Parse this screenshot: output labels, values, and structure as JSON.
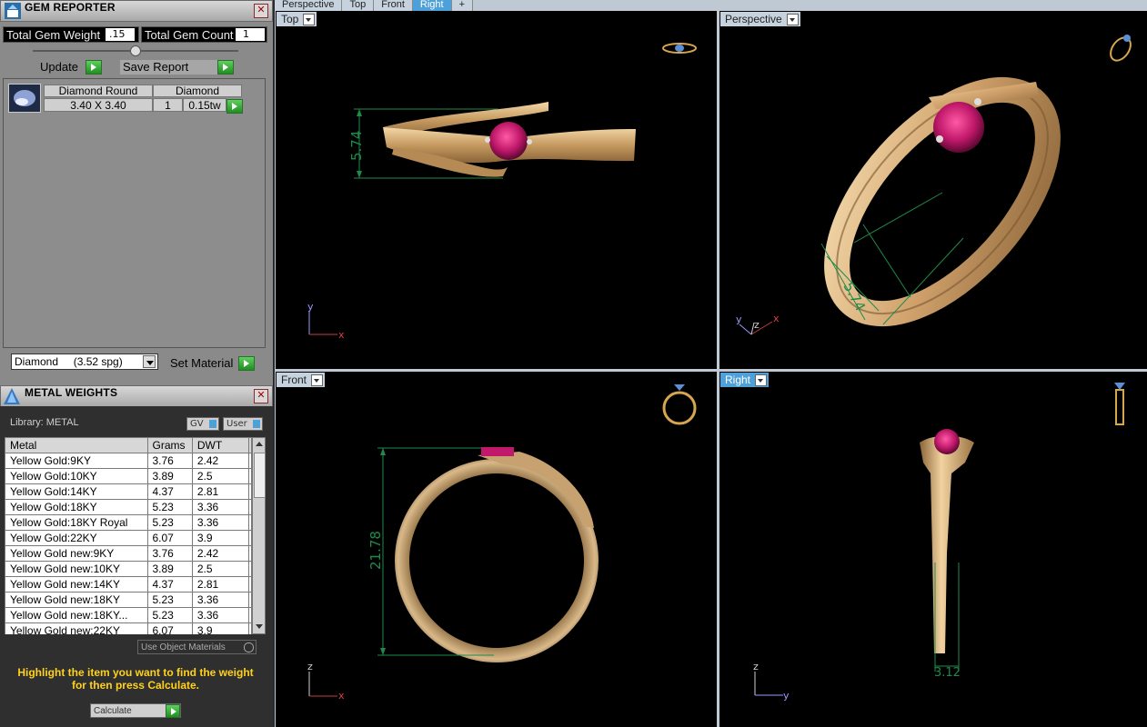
{
  "gem_reporter": {
    "title": "GEM REPORTER",
    "total_weight_label": "Total Gem Weight",
    "total_weight_value": ".15",
    "total_count_label": "Total Gem Count",
    "total_count_value": "1",
    "update_label": "Update",
    "save_report_label": "Save Report",
    "table_headers": [
      "Diamond Round",
      "Diamond"
    ],
    "gem_row": {
      "size": "3.40 X 3.40",
      "count": "1",
      "weight": "0.15tw"
    },
    "material_select": "Diamond     (3.52 spg)",
    "set_material_label": "Set Material"
  },
  "metal_weights": {
    "title": "METAL WEIGHTS",
    "library_label": "Library: METAL",
    "toggle_gv": "GV",
    "toggle_user": "User",
    "columns": [
      "Metal",
      "Grams",
      "DWT"
    ],
    "rows": [
      [
        "Yellow Gold:9KY",
        "3.76",
        "2.42"
      ],
      [
        "Yellow Gold:10KY",
        "3.89",
        "2.5"
      ],
      [
        "Yellow Gold:14KY",
        "4.37",
        "2.81"
      ],
      [
        "Yellow Gold:18KY",
        "5.23",
        "3.36"
      ],
      [
        "Yellow Gold:18KY Royal",
        "5.23",
        "3.36"
      ],
      [
        "Yellow Gold:22KY",
        "6.07",
        "3.9"
      ],
      [
        "Yellow Gold new:9KY",
        "3.76",
        "2.42"
      ],
      [
        "Yellow Gold new:10KY",
        "3.89",
        "2.5"
      ],
      [
        "Yellow Gold new:14KY",
        "4.37",
        "2.81"
      ],
      [
        "Yellow Gold new:18KY",
        "5.23",
        "3.36"
      ],
      [
        "Yellow Gold new:18KY...",
        "5.23",
        "3.36"
      ],
      [
        "Yellow Gold new:22KY",
        "6.07",
        "3.9"
      ]
    ],
    "use_object_materials": "Use Object Materials",
    "hint": "Highlight the item you want to find the weight for then press Calculate.",
    "calculate_label": "Calculate"
  },
  "viewport_tabs": [
    "Perspective",
    "Top",
    "Front",
    "Right",
    "+"
  ],
  "active_tab": "Right",
  "viewports": {
    "top": {
      "label": "Top",
      "dimension": "5.74",
      "axis1": "y",
      "axis2": "x"
    },
    "perspective": {
      "label": "Perspective",
      "dimension": "5.74",
      "axis1": "y",
      "axis2": "z",
      "axis3": "x"
    },
    "front": {
      "label": "Front",
      "dimension": "21.78",
      "axis1": "z",
      "axis2": "x"
    },
    "right": {
      "label": "Right",
      "dimension": "3.12",
      "axis1": "z",
      "axis2": "y"
    }
  },
  "colors": {
    "gold": "#d9b07a",
    "ruby": "#c0186a",
    "dimension_green": "#1f8a4a",
    "hint_text": "#ffd21a",
    "active_tab": "#4ea0d8"
  }
}
